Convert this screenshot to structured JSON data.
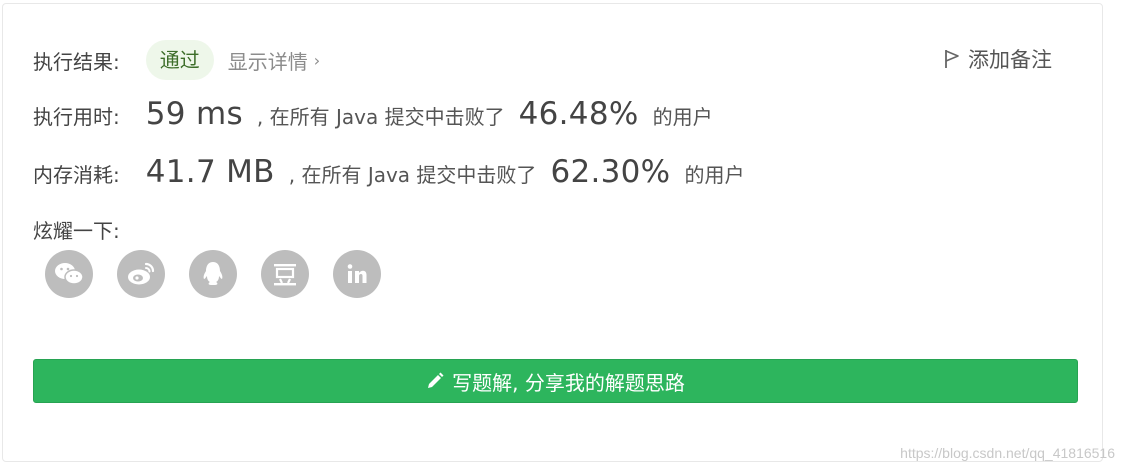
{
  "result": {
    "label": "执行结果:",
    "status": "通过",
    "details_link": "显示详情",
    "add_note": "添加备注"
  },
  "runtime": {
    "label": "执行用时:",
    "value": "59 ms",
    "mid_text": ", 在所有 Java 提交中击败了",
    "percent": "46.48%",
    "tail": "的用户"
  },
  "memory": {
    "label": "内存消耗:",
    "value": "41.7 MB",
    "mid_text": ", 在所有 Java 提交中击败了",
    "percent": "62.30%",
    "tail": "的用户"
  },
  "share": {
    "label": "炫耀一下:",
    "icons": [
      "wechat-icon",
      "weibo-icon",
      "qq-icon",
      "douban-icon",
      "linkedin-icon"
    ]
  },
  "write_button": {
    "label": "写题解, 分享我的解题思路"
  },
  "watermark": "https://blog.csdn.net/qq_41816516",
  "colors": {
    "accent_green": "#2db55d",
    "pass_bg": "#eef7ea",
    "icon_gray": "#bdbdbd"
  }
}
